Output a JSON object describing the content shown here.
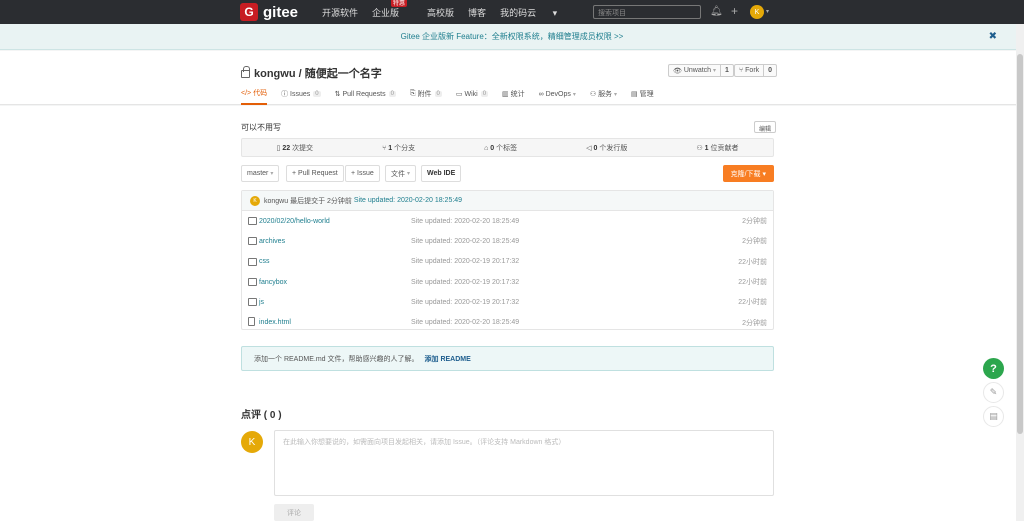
{
  "topbar": {
    "logo_mark": "G",
    "logo_text": "gitee",
    "nav": [
      {
        "label": "开源软件"
      },
      {
        "label": "企业版",
        "badge": "特惠"
      },
      {
        "label": "高校版"
      },
      {
        "label": "博客"
      },
      {
        "label": "我的码云"
      }
    ],
    "search_placeholder": "搜索项目",
    "avatar_letter": "K"
  },
  "notice": {
    "text": "Gitee 企业版新 Feature：全新权限系统，精细管理成员权限 >>",
    "close": "✖"
  },
  "repo": {
    "title": "kongwu / 随便起一个名字",
    "watch_label": "Unwatch",
    "watch_count": "1",
    "fork_label": "Fork",
    "fork_count": "0",
    "tabs": [
      {
        "label": "代码",
        "count": ""
      },
      {
        "label": "Issues",
        "count": "0"
      },
      {
        "label": "Pull Requests",
        "count": "0"
      },
      {
        "label": "附件",
        "count": "0"
      },
      {
        "label": "Wiki",
        "count": "0"
      },
      {
        "label": "统计",
        "count": ""
      },
      {
        "label": "DevOps",
        "count": ""
      },
      {
        "label": "服务",
        "count": ""
      },
      {
        "label": "管理",
        "count": ""
      }
    ]
  },
  "main": {
    "description": "可以不用写",
    "edit_label": "编辑",
    "stats": {
      "commits_num": "22",
      "commits_label": "次提交",
      "branches_num": "1",
      "branches_label": "个分支",
      "tags_num": "0",
      "tags_label": "个标签",
      "releases_num": "0",
      "releases_label": "个发行版",
      "contributors_num": "1",
      "contributors_label": "位贡献者"
    },
    "toolbar": {
      "branch": "master",
      "pull_request": "+ Pull Request",
      "issue": "+ Issue",
      "file": "文件",
      "web_ide": "Web IDE",
      "clone": "克隆/下载"
    },
    "commit": {
      "avatar": "K",
      "text": "kongwu 最后提交于 2分钟前",
      "message": "Site updated: 2020-02-20 18:25:49"
    },
    "files": [
      {
        "name": "2020/02/20/hello-world",
        "message": "Site updated: 2020-02-20 18:25:49",
        "time": "2分钟前",
        "type": "folder"
      },
      {
        "name": "archives",
        "message": "Site updated: 2020-02-20 18:25:49",
        "time": "2分钟前",
        "type": "folder"
      },
      {
        "name": "css",
        "message": "Site updated: 2020-02-19 20:17:32",
        "time": "22小时前",
        "type": "folder"
      },
      {
        "name": "fancybox",
        "message": "Site updated: 2020-02-19 20:17:32",
        "time": "22小时前",
        "type": "folder"
      },
      {
        "name": "js",
        "message": "Site updated: 2020-02-19 20:17:32",
        "time": "22小时前",
        "type": "folder"
      },
      {
        "name": "index.html",
        "message": "Site updated: 2020-02-20 18:25:49",
        "time": "2分钟前",
        "type": "file"
      }
    ],
    "readme": {
      "text": "添加一个 README.md 文件，帮助感兴趣的人了解。",
      "link": "添加 README"
    }
  },
  "comments": {
    "title": "点评 ( 0 )",
    "avatar": "K",
    "placeholder": "在此输入你想要说的，如需面向项目发起相关，请添加 Issue。（评论支持 Markdown 格式）",
    "submit": "评论"
  },
  "float": {
    "help": "?"
  },
  "colors": {
    "brand": "#c71d23",
    "accent": "#f87d22",
    "link": "#1e7e8e",
    "help": "#2ca64d"
  }
}
